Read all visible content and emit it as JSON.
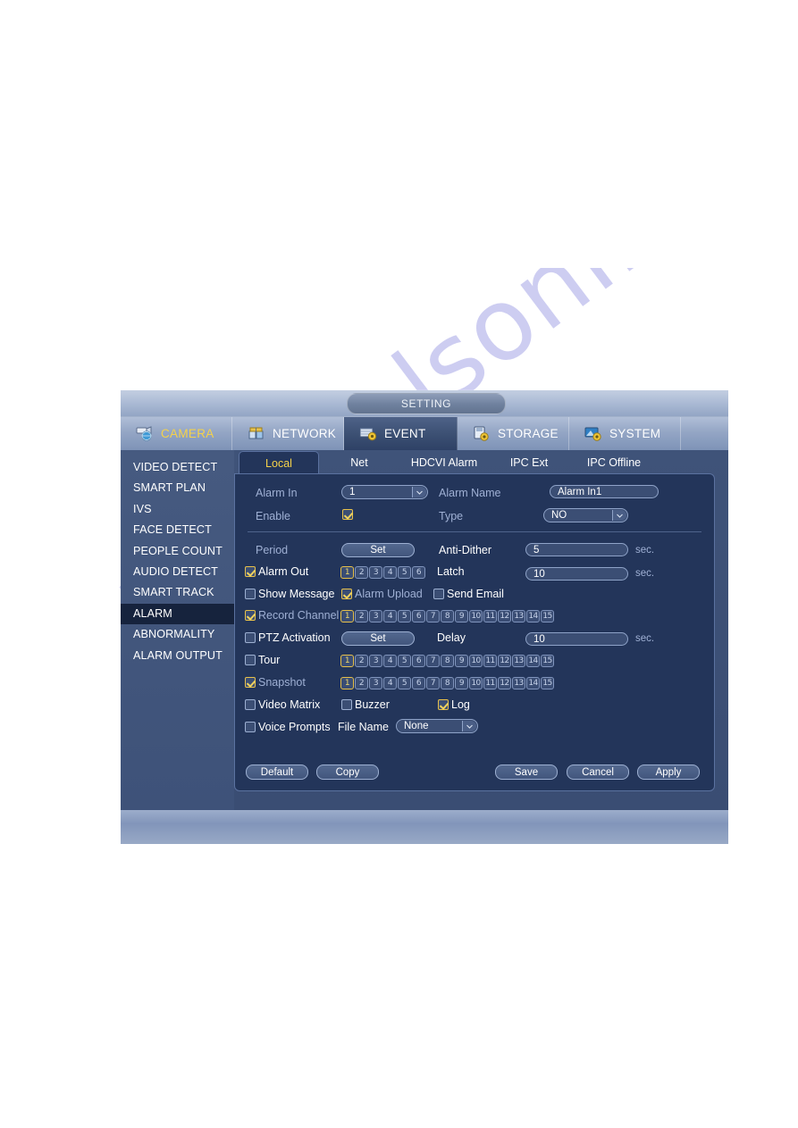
{
  "window": {
    "title": "SETTING"
  },
  "main_tabs": [
    {
      "label": "CAMERA",
      "icon": "camera-icon",
      "state": "hover"
    },
    {
      "label": "NETWORK",
      "icon": "network-icon",
      "state": "normal"
    },
    {
      "label": "EVENT",
      "icon": "event-icon",
      "state": "active"
    },
    {
      "label": "STORAGE",
      "icon": "storage-icon",
      "state": "normal"
    },
    {
      "label": "SYSTEM",
      "icon": "system-icon",
      "state": "normal"
    }
  ],
  "sidebar": {
    "items": [
      {
        "label": "VIDEO DETECT",
        "active": false
      },
      {
        "label": "SMART PLAN",
        "active": false
      },
      {
        "label": "IVS",
        "active": false
      },
      {
        "label": "FACE DETECT",
        "active": false
      },
      {
        "label": "PEOPLE COUNT",
        "active": false
      },
      {
        "label": "AUDIO DETECT",
        "active": false
      },
      {
        "label": "SMART TRACK",
        "active": false
      },
      {
        "label": "ALARM",
        "active": true
      },
      {
        "label": "ABNORMALITY",
        "active": false
      },
      {
        "label": "ALARM OUTPUT",
        "active": false
      }
    ]
  },
  "sub_tabs": [
    {
      "label": "Local",
      "active": true
    },
    {
      "label": "Net",
      "active": false
    },
    {
      "label": "HDCVI Alarm",
      "active": false
    },
    {
      "label": "IPC Ext",
      "active": false
    },
    {
      "label": "IPC Offline",
      "active": false
    }
  ],
  "form": {
    "alarm_in_label": "Alarm In",
    "alarm_in_value": "1",
    "alarm_name_label": "Alarm Name",
    "alarm_name_value": "Alarm In1",
    "enable_label": "Enable",
    "enable_checked": true,
    "type_label": "Type",
    "type_value": "NO",
    "period_label": "Period",
    "period_button": "Set",
    "anti_dither_label": "Anti-Dither",
    "anti_dither_value": "5",
    "anti_dither_unit": "sec.",
    "alarm_out_label": "Alarm Out",
    "alarm_out_checked": true,
    "alarm_out_channels": [
      "1",
      "2",
      "3",
      "4",
      "5",
      "6"
    ],
    "alarm_out_selected": [
      "1"
    ],
    "latch_label": "Latch",
    "latch_value": "10",
    "latch_unit": "sec.",
    "show_message_label": "Show Message",
    "show_message_checked": false,
    "alarm_upload_label": "Alarm Upload",
    "alarm_upload_checked": true,
    "send_email_label": "Send Email",
    "send_email_checked": false,
    "record_channel_label": "Record Channel",
    "record_channel_checked": true,
    "record_channels": [
      "1",
      "2",
      "3",
      "4",
      "5",
      "6",
      "7",
      "8",
      "9",
      "10",
      "11",
      "12",
      "13",
      "14",
      "15"
    ],
    "record_channels_selected": [
      "1"
    ],
    "ptz_activation_label": "PTZ Activation",
    "ptz_activation_checked": false,
    "ptz_button": "Set",
    "delay_label": "Delay",
    "delay_value": "10",
    "delay_unit": "sec.",
    "tour_label": "Tour",
    "tour_checked": false,
    "tour_channels": [
      "1",
      "2",
      "3",
      "4",
      "5",
      "6",
      "7",
      "8",
      "9",
      "10",
      "11",
      "12",
      "13",
      "14",
      "15"
    ],
    "tour_selected": [
      "1"
    ],
    "snapshot_label": "Snapshot",
    "snapshot_checked": true,
    "snapshot_channels": [
      "1",
      "2",
      "3",
      "4",
      "5",
      "6",
      "7",
      "8",
      "9",
      "10",
      "11",
      "12",
      "13",
      "14",
      "15"
    ],
    "snapshot_selected": [
      "1"
    ],
    "video_matrix_label": "Video Matrix",
    "video_matrix_checked": false,
    "buzzer_label": "Buzzer",
    "buzzer_checked": false,
    "log_label": "Log",
    "log_checked": true,
    "voice_prompts_label": "Voice Prompts",
    "voice_prompts_checked": false,
    "file_name_label": "File Name",
    "file_name_value": "None"
  },
  "buttons": {
    "default": "Default",
    "copy": "Copy",
    "save": "Save",
    "cancel": "Cancel",
    "apply": "Apply"
  },
  "watermark": {
    "text": "manualsonline.com"
  },
  "colors": {
    "accent_yellow": "#f5d24a",
    "panel_bg": "#23355a",
    "active_tab": "#16233d",
    "label_blue": "#9fb0d4"
  }
}
